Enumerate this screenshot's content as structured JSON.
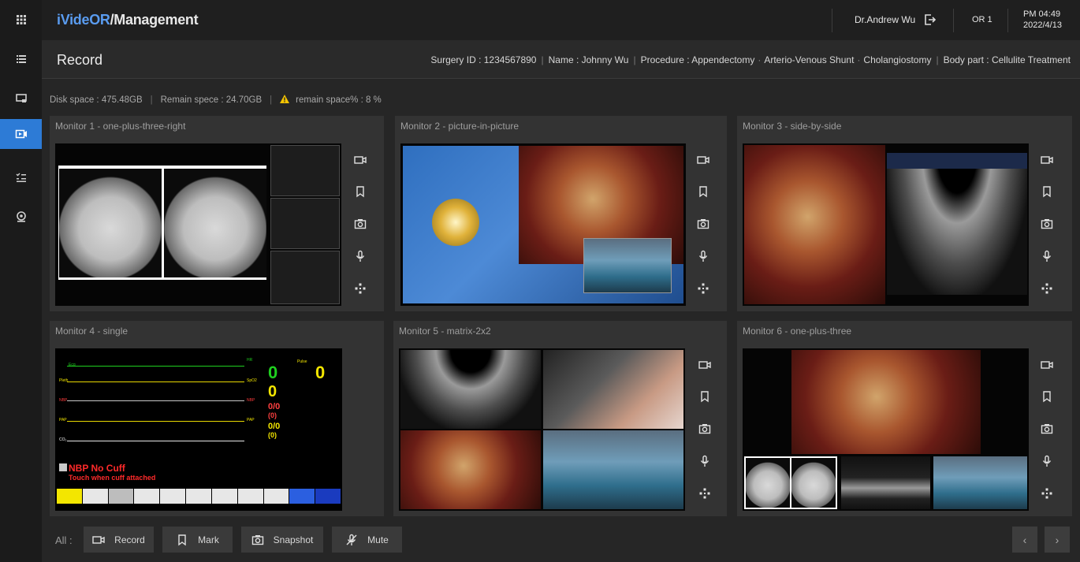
{
  "app": {
    "brand_part1": "iVideOR",
    "brand_part2": "/Management",
    "user": "Dr.Andrew Wu",
    "room": "OR 1",
    "time": "PM 04:49",
    "date": "2022/4/13"
  },
  "page": {
    "title": "Record",
    "surgery_id": "Surgery ID : 1234567890",
    "name": "Name : Johnny Wu",
    "procedure": "Procedure : Appendectomy",
    "procedure_2": "Arterio-Venous Shunt",
    "procedure_3": "Cholangiostomy",
    "body_part": "Body part : Cellulite Treatment"
  },
  "disk": {
    "space": "Disk space : 475.48GB",
    "remain": "Remain spece : 24.70GB",
    "remain_pct": "remain space% : 8 %"
  },
  "rail": {
    "icons": [
      "apps-grid-icon",
      "list-icon",
      "monitor-icon",
      "record-video-icon",
      "checklist-icon",
      "camera-pin-icon"
    ],
    "active_index": 3
  },
  "monitors": [
    {
      "title": "Monitor 1 - one-plus-three-right"
    },
    {
      "title": "Monitor 2 - picture-in-picture"
    },
    {
      "title": "Monitor 3 - side-by-side"
    },
    {
      "title": "Monitor 4 - single"
    },
    {
      "title": "Monitor 5  - matrix-2x2"
    },
    {
      "title": "Monitor 6 - one-plus-three"
    }
  ],
  "vitals": {
    "hr": "HR",
    "spo2": "SpO2",
    "nbp": "NBP",
    "pap": "PAP",
    "co2": "CO₂",
    "pulse": "Pulse",
    "pleth": "Pleth",
    "ecg": "Ecg",
    "zero": "0",
    "zero_zero": "0/0",
    "paren_zero": "(0)",
    "nbp_alarm": "NBP No Cuff",
    "nbp_hint": "Touch when cuff attached"
  },
  "allbar": {
    "label": "All :",
    "record": "Record",
    "mark": "Mark",
    "snapshot": "Snapshot",
    "mute": "Mute",
    "prev": "‹",
    "next": "›"
  },
  "colors": {
    "accent": "#2d7bd6",
    "brand_blue": "#5a9cf0",
    "warning": "#f5c400"
  }
}
